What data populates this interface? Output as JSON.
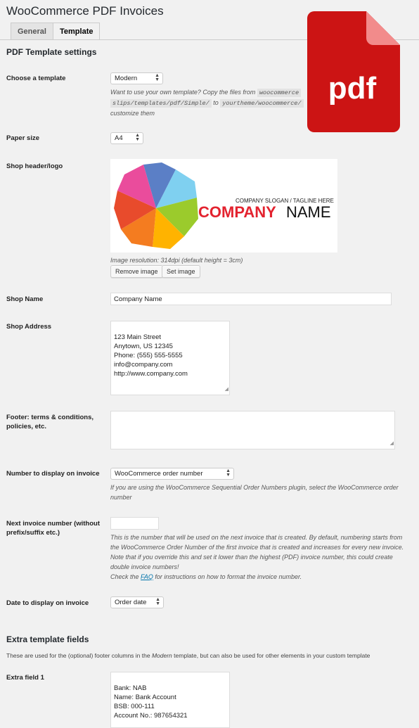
{
  "page": {
    "title": "WooCommerce PDF Invoices",
    "tabs": [
      "General",
      "Template"
    ],
    "active_tab": "Template"
  },
  "section": {
    "title": "PDF Template settings"
  },
  "template": {
    "label": "Choose a template",
    "value": "Modern",
    "desc_prefix": "Want to use your own template? Copy the files from",
    "code1": "woocommerce",
    "code1b": "slips/templates/pdf/Simple/",
    "desc_mid": "to",
    "code2": "yourtheme/woocommerce/",
    "desc_suffix": "customize them"
  },
  "paper": {
    "label": "Paper size",
    "value": "A4"
  },
  "logo": {
    "label": "Shop header/logo",
    "slogan": "COMPANY SLOGAN / TAGLINE HERE",
    "company_red": "COMPANY",
    "company_black": "NAME",
    "resolution": "Image resolution: 314dpi (default height = 3cm)",
    "remove_label": "Remove image",
    "set_label": "Set image"
  },
  "shop_name": {
    "label": "Shop Name",
    "value": "Company Name"
  },
  "shop_address": {
    "label": "Shop Address",
    "value": "123 Main Street\nAnytown, US 12345\nPhone: (555) 555-5555\ninfo@company.com\nhttp://www.company.com"
  },
  "footer": {
    "label": "Footer: terms & conditions, policies, etc.",
    "value": ""
  },
  "number_display": {
    "label": "Number to display on invoice",
    "value": "WooCommerce order number",
    "desc": "If you are using the WooCommerce Sequential Order Numbers plugin, select the WooCommerce order number"
  },
  "next_invoice": {
    "label": "Next invoice number (without prefix/suffix etc.)",
    "value": "",
    "desc": "This is the number that will be used on the next invoice that is created. By default, numbering starts from the WooCommerce Order Number of the first invoice that is created and increases for every new invoice. Note that if you override this and set it lower than the highest (PDF) invoice number, this could create double invoice numbers!",
    "check_prefix": "Check the",
    "faq_link": "FAQ",
    "check_suffix": "for instructions on how to format the invoice number."
  },
  "date_display": {
    "label": "Date to display on invoice",
    "value": "Order date"
  },
  "extra": {
    "title": "Extra template fields",
    "note_prefix": "These are used for the (optional) footer columns in the",
    "note_em": "Modern",
    "note_suffix": "template, but can also be used for other elements in your custom template",
    "field1_label": "Extra field 1",
    "field1_value": "Bank: NAB\nName: Bank Account\nBSB: 000-111\nAccount No.: 987654321"
  },
  "badge": {
    "text": "pdf"
  },
  "colors": {
    "badge_red": "#cc1414",
    "badge_fold": "#f28b8b",
    "link": "#0073aa"
  }
}
